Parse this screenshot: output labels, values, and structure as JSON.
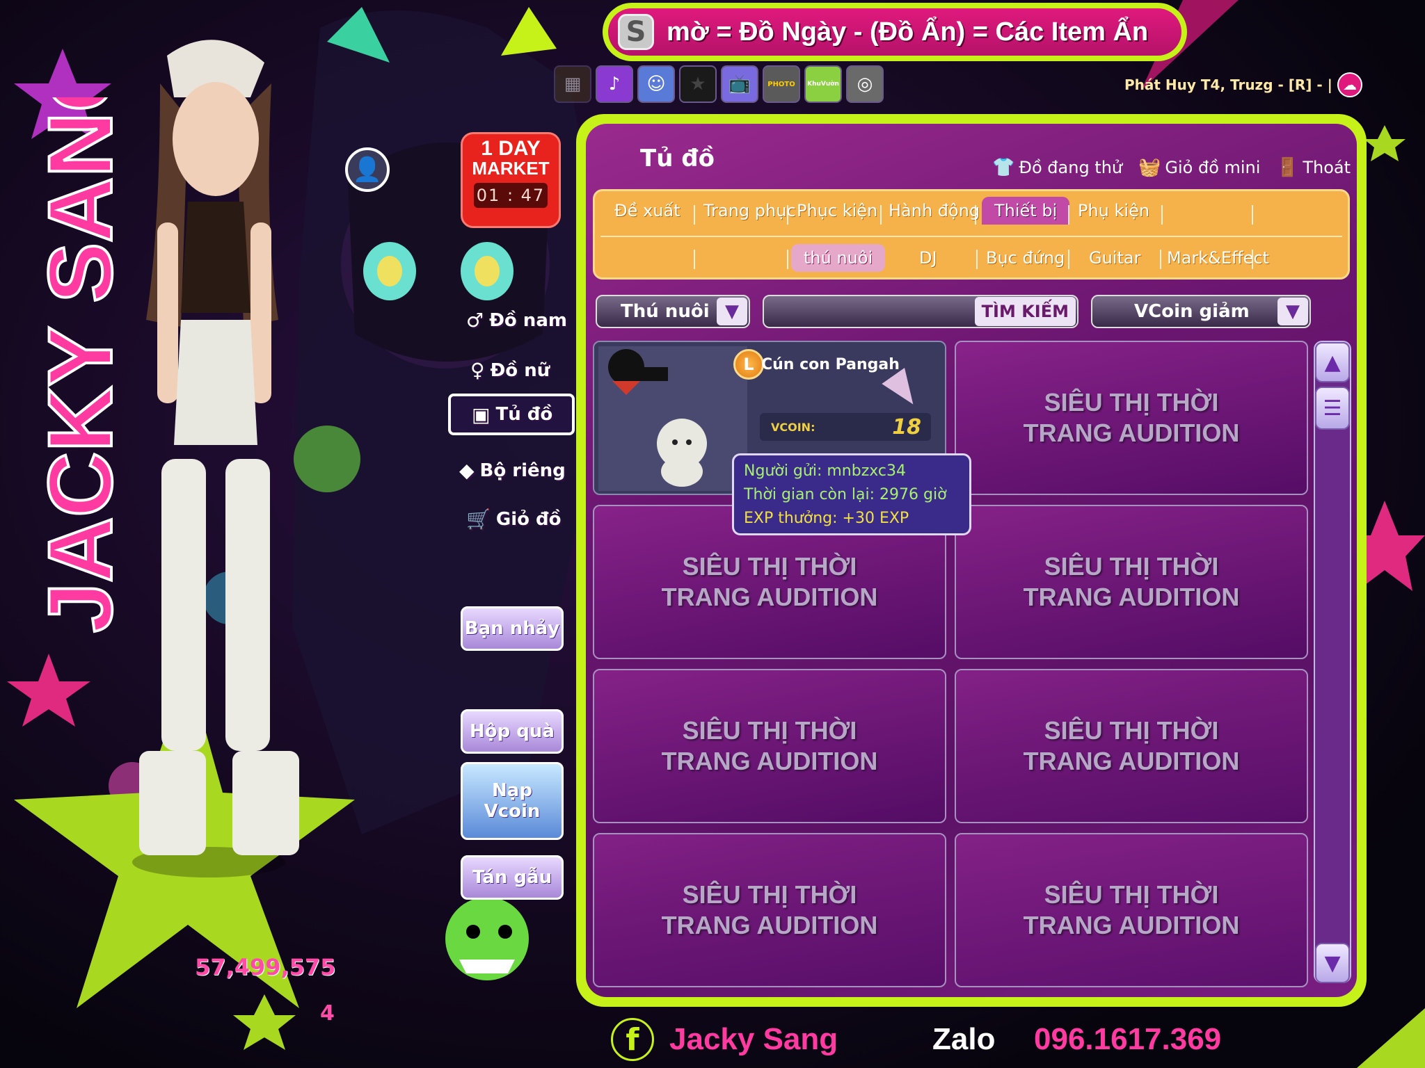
{
  "banner": {
    "badge": "S",
    "text": "mờ = Đồ Ngày  -  (Đồ Ẩn) = Các Item Ẩn"
  },
  "ribbon_text": "Phát Huy T4, Truzg - [R] - |",
  "iconrow": {
    "photo_label": "PHOTO",
    "khuvuon_label": "KhuVườn"
  },
  "window": {
    "title": "Tủ đồ",
    "actions": [
      {
        "label": "Đồ đang thử",
        "icon": "shirt-icon"
      },
      {
        "label": "Giỏ đồ mini",
        "icon": "basket-icon"
      },
      {
        "label": "Thoát",
        "icon": "exit-door-icon"
      }
    ]
  },
  "tabs": [
    "Đề xuất",
    "Trang phục",
    "Phục kiện",
    "Hành động",
    "Thiết bị",
    "Phụ kiện"
  ],
  "active_tab": "Thiết bị",
  "subtabs": [
    "thú nuôi",
    "DJ",
    "Bục đứng",
    "Guitar",
    "Mark&Effect"
  ],
  "active_subtab": "thú nuôi",
  "filters": {
    "category": "Thú nuôi",
    "search_value": "",
    "search_button": "TÌM KIẾM",
    "sort": "VCoin giảm"
  },
  "item": {
    "name": "Cún con Pangah",
    "badge": "L",
    "price_label": "VCOIN:",
    "price": "18"
  },
  "tooltip": {
    "sender": "Người gửi: mnbzxc34",
    "time_left": "Thời gian còn lại: 2976 giờ",
    "exp": "EXP thưởng: +30 EXP"
  },
  "placeholder": {
    "line1": "SIÊU THỊ THỜI",
    "line2": "TRANG AUDITION"
  },
  "left_menu": [
    {
      "label": "Đồ nam",
      "icon": "male-icon"
    },
    {
      "label": "Đồ nữ",
      "icon": "female-icon"
    },
    {
      "label": "Tủ đồ",
      "icon": "wardrobe-icon"
    },
    {
      "label": "Bộ riêng",
      "icon": "set-icon"
    },
    {
      "label": "Giỏ đồ",
      "icon": "cart-icon"
    }
  ],
  "side_buttons": {
    "dance_partner": "Bạn nhảy",
    "gift_box": "Hộp quà",
    "topup_line1": "Nạp",
    "topup_line2": "Vcoin",
    "chat": "Tán gẫu"
  },
  "market": {
    "line1": "1 DAY",
    "line2": "MARKET",
    "timer": "01 : 47"
  },
  "money": "57,499,575",
  "level": "4",
  "watermark": "JACKY SANG",
  "footer": {
    "fb": "f",
    "name": "Jacky Sang",
    "zalo": "Zalo",
    "phone": "096.1617.369"
  },
  "colors": {
    "lime": "#c6f21a",
    "magenta": "#e0197d",
    "window": "#6a1670",
    "tab_orange": "#f5b24a"
  }
}
